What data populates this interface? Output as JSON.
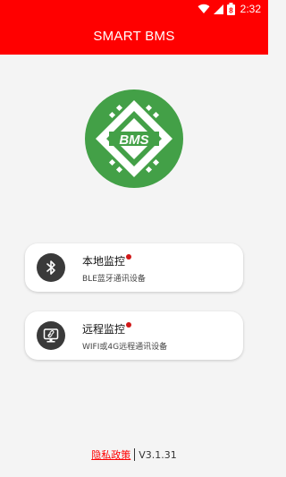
{
  "status_bar": {
    "time": "2:32",
    "battery_level": "8",
    "icons": [
      "wifi-icon",
      "cellular-signal-icon",
      "battery-icon"
    ]
  },
  "header": {
    "title": "SMART BMS",
    "background_color": "#ff0000"
  },
  "logo": {
    "text": "BMS",
    "color": "#43a047"
  },
  "menu": [
    {
      "title": "本地监控",
      "subtitle": "BLE蓝牙通讯设备",
      "icon": "bluetooth-icon"
    },
    {
      "title": "远程监控",
      "subtitle": "WIFI或4G远程通讯设备",
      "icon": "remote-monitor-icon"
    }
  ],
  "footer": {
    "privacy_label": "隐私政策",
    "version": "V3.1.31"
  }
}
